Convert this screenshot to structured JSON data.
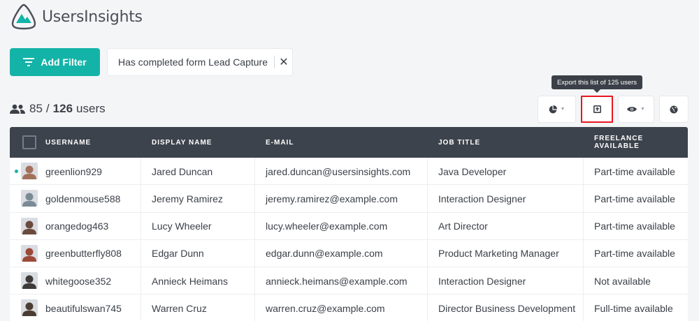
{
  "app": {
    "name": "UsersInsights",
    "brand_color": "#14b3a7"
  },
  "toolbar": {
    "add_filter_label": "Add Filter",
    "active_filter": "Has completed form Lead Capture",
    "tooltip": "Export this list of 125 users"
  },
  "counts": {
    "shown": "85",
    "separator": "/",
    "total": "126",
    "unit": "users"
  },
  "actions": [
    {
      "icon": "pie-chart-icon"
    },
    {
      "icon": "export-icon"
    },
    {
      "icon": "eye-icon"
    },
    {
      "icon": "globe-icon"
    }
  ],
  "table": {
    "columns": [
      "USERNAME",
      "DISPLAY NAME",
      "E-MAIL",
      "JOB TITLE",
      "FREELANCE AVAILABLE"
    ],
    "rows": [
      {
        "username": "greenlion929",
        "display_name": "Jared Duncan",
        "email": "jared.duncan@usersinsights.com",
        "job_title": "Java Developer",
        "freelance": "Part-time available",
        "online": true,
        "avatar_color": "#a3705a"
      },
      {
        "username": "goldenmouse588",
        "display_name": "Jeremy Ramirez",
        "email": "jeremy.ramirez@example.com",
        "job_title": "Interaction Designer",
        "freelance": "Part-time available",
        "online": false,
        "avatar_color": "#7a8a95"
      },
      {
        "username": "orangedog463",
        "display_name": "Lucy Wheeler",
        "email": "lucy.wheeler@example.com",
        "job_title": "Art Director",
        "freelance": "Part-time available",
        "online": false,
        "avatar_color": "#6b4a3e"
      },
      {
        "username": "greenbutterfly808",
        "display_name": "Edgar Dunn",
        "email": "edgar.dunn@example.com",
        "job_title": "Product Marketing Manager",
        "freelance": "Part-time available",
        "online": false,
        "avatar_color": "#9c4a38"
      },
      {
        "username": "whitegoose352",
        "display_name": "Annieck Heimans",
        "email": "annieck.heimans@example.com",
        "job_title": "Interaction Designer",
        "freelance": "Not available",
        "online": false,
        "avatar_color": "#3e3a3a"
      },
      {
        "username": "beautifulswan745",
        "display_name": "Warren Cruz",
        "email": "warren.cruz@example.com",
        "job_title": "Director Business Development",
        "freelance": "Full-time available",
        "online": false,
        "avatar_color": "#4b3d33"
      }
    ]
  }
}
